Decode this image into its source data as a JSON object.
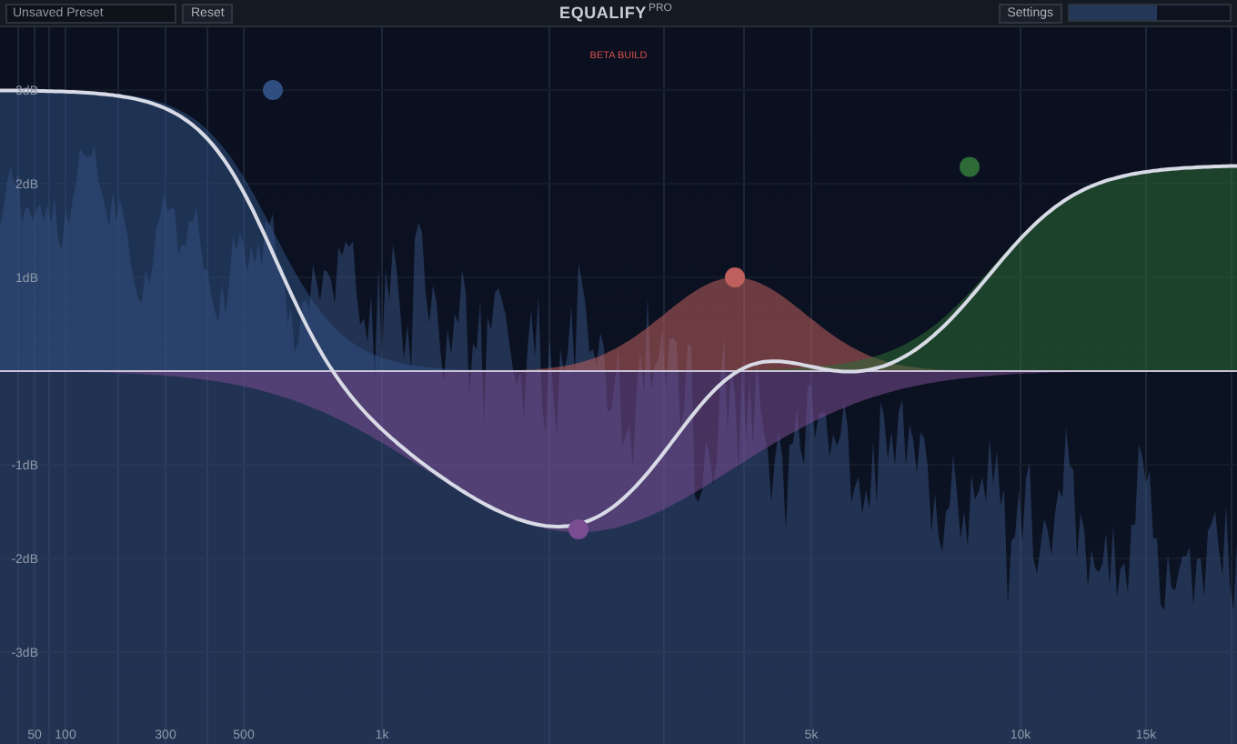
{
  "preset": {
    "placeholder": "Unsaved Preset"
  },
  "reset_button": "Reset",
  "title": "EQUALIFY",
  "title_badge": "PRO",
  "settings_button": "Settings",
  "output_meter": {
    "level": 0.55
  },
  "build_label": "BETA BUILD",
  "db_labels": [
    "3dB",
    "2dB",
    "1dB",
    "-1dB",
    "-2dB",
    "-3dB"
  ],
  "freq_labels": [
    "50",
    "100",
    "300",
    "500",
    "1k",
    "5k",
    "10k",
    "15k"
  ],
  "bands": [
    {
      "kind": "low-shelf",
      "color": "#2f4f80"
    },
    {
      "kind": "peak",
      "color": "#c0605e"
    },
    {
      "kind": "high-shelf",
      "color": "#2e6b37"
    },
    {
      "kind": "dip",
      "color": "#7a4c92"
    }
  ]
}
